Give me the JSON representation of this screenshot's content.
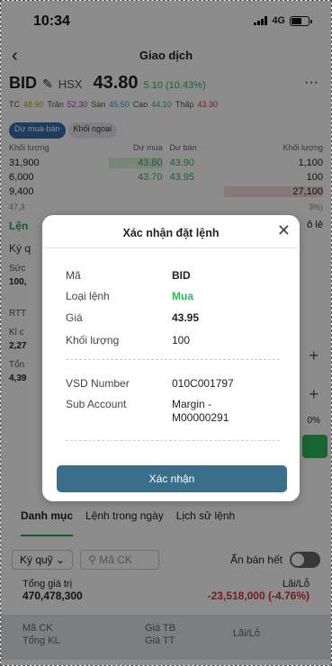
{
  "status": {
    "time": "10:34",
    "network": "4G"
  },
  "nav": {
    "title": "Giao dịch"
  },
  "quote": {
    "symbol": "BID",
    "exchange": "HSX",
    "price": "43.80",
    "change": "5.10 (10.43%)"
  },
  "refs": {
    "tc_label": "TC",
    "tc": "48.90",
    "tran_label": "Trần",
    "tran": "52.30",
    "san_label": "Sàn",
    "san": "45.50",
    "cao_label": "Cao",
    "cao": "44.10",
    "thap_label": "Thấp",
    "thap": "43.30"
  },
  "chips": {
    "bid_ask": "Dư mua-bán",
    "foreign": "Khối ngoại"
  },
  "orderbook": {
    "headers": {
      "vol_left": "Khối lượng",
      "bid": "Dư mua",
      "ask": "Dư bán",
      "vol_right": "Khối lượng"
    },
    "rows": [
      {
        "vol_left": "31,900",
        "bid": "43.80",
        "ask": "43.90",
        "vol_right": "1,100"
      },
      {
        "vol_left": "6,000",
        "bid": "43.70",
        "ask": "43.95",
        "vol_right": "100"
      },
      {
        "vol_left": "9,400",
        "bid": "",
        "ask": "",
        "vol_right": "27,100"
      }
    ],
    "pct_left": "47,3",
    "pct_right": "3%)"
  },
  "bg_form": {
    "tab": "Lện",
    "odd_lot": "ô lẻ",
    "ky": "Ký q",
    "suc": "Sức",
    "suc_val": "100,",
    "rtt": "RTT",
    "kl": "Kl c",
    "kl_val": "2,27",
    "tong": "Tổn",
    "tong_val": "4,39",
    "pct": "0%"
  },
  "bottom_tabs": [
    "Danh mục",
    "Lệnh trong ngày",
    "Lịch sử lệnh"
  ],
  "filters": {
    "margin": "Ký quỹ",
    "search_placeholder": "Mã CK",
    "hide_sold": "Ẩn bán hết"
  },
  "totals": {
    "label": "Tổng giá trị",
    "value": "470,478,300",
    "pl_label": "Lãi/Lỗ",
    "pl_value": "-23,518,000 (-4.76%)"
  },
  "table_head": {
    "c1a": "Mã CK",
    "c1b": "Tổng KL",
    "c2a": "Giá TB",
    "c2b": "Giá TT",
    "c3": "Lãi/Lỗ"
  },
  "modal": {
    "title": "Xác nhận đặt lệnh",
    "rows": [
      {
        "label": "Mã",
        "value": "BID"
      },
      {
        "label": "Loại lệnh",
        "value": "Mua"
      },
      {
        "label": "Giá",
        "value": "43.95"
      },
      {
        "label": "Khối lượng",
        "value": "100"
      }
    ],
    "vsd_label": "VSD Number",
    "vsd_value": "010C001797",
    "sub_label": "Sub Account",
    "sub_value": "Margin - M00000291",
    "confirm": "Xác nhận"
  }
}
